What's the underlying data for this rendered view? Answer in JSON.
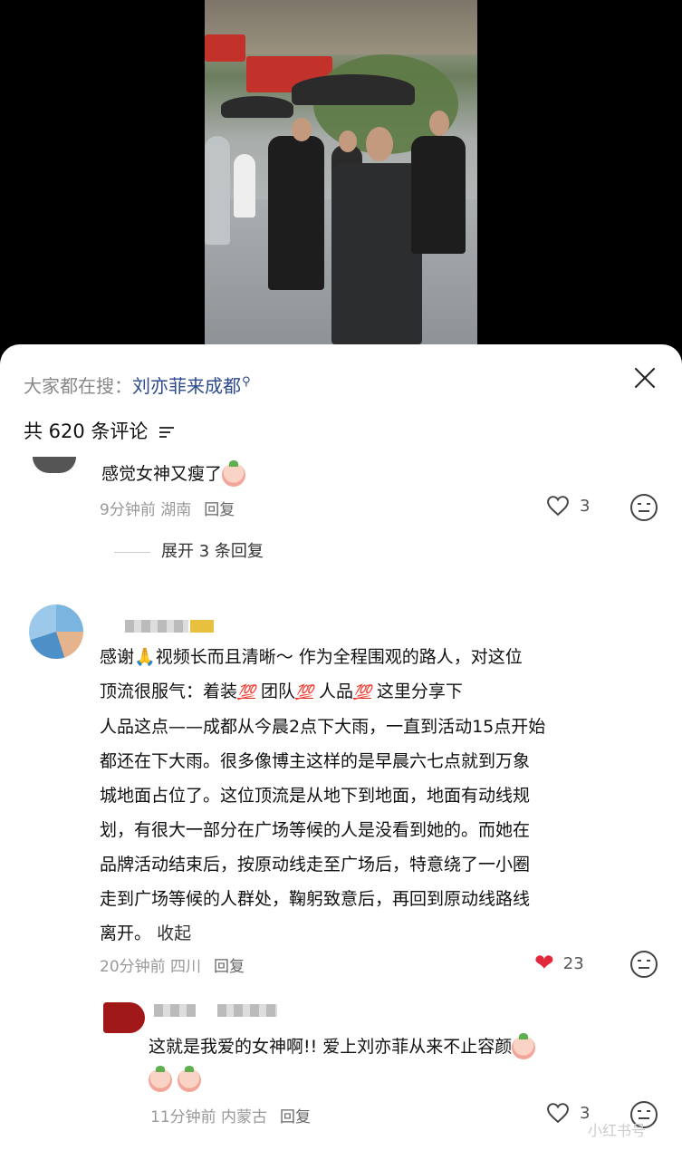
{
  "search": {
    "prefix": "大家都在搜：",
    "query": "刘亦菲来成都"
  },
  "comments_header": {
    "count_text": "共 620 条评论"
  },
  "comment1": {
    "text": "感觉女神又瘦了",
    "time_location": "9分钟前 湖南",
    "reply_label": "回复",
    "likes": "3",
    "expand_label": "展开 3 条回复"
  },
  "comment2": {
    "line1_a": "感谢",
    "line1_b": "视频长而且清晰～  作为全程围观的路人，对这位",
    "line2_a": "顶流很服气：着装",
    "line2_b": " 团队",
    "line2_c": " 人品",
    "line2_d": "      这里分享下",
    "line3": "人品这点——成都从今晨2点下大雨，一直到活动15点开始",
    "line4": "都还在下大雨。很多像博主这样的是早晨六七点就到万象",
    "line5": "城地面占位了。这位顶流是从地下到地面，地面有动线规",
    "line6": "划，有很大一部分在广场等候的人是没看到她的。而她在",
    "line7": "品牌活动结束后，按原动线走至广场后，特意绕了一小圈",
    "line8": "走到广场等候的人群处，鞠躬致意后，再回到原动线路线",
    "line9_a": "离开。",
    "line9_b": "收起",
    "hundred": "💯",
    "time_location": "20分钟前 四川",
    "reply_label": "回复",
    "likes": "23"
  },
  "reply1": {
    "text": "这就是我爱的女神啊!! 爱上刘亦菲从来不止容颜",
    "time_location": "11分钟前 内蒙古",
    "reply_label": "回复",
    "likes": "3"
  },
  "watermark": "小红书号"
}
